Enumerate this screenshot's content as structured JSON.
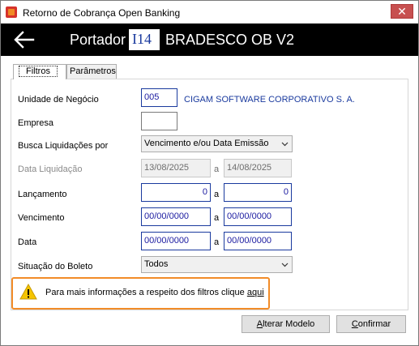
{
  "window": {
    "title": "Retorno de Cobrança Open Banking",
    "close_glyph": "✕"
  },
  "header": {
    "back_icon": "back-arrow-icon",
    "portador_label": "Portador",
    "portador_code": "I14",
    "portador_name": "BRADESCO OB V2"
  },
  "tabs": [
    {
      "label": "Filtros",
      "active": true
    },
    {
      "label": "Parâmetros",
      "active": false
    }
  ],
  "form": {
    "unidade_negocio": {
      "label": "Unidade de Negócio",
      "value": "005",
      "description": "CIGAM SOFTWARE CORPORATIVO S. A."
    },
    "empresa": {
      "label": "Empresa",
      "value": ""
    },
    "busca_liquidacoes": {
      "label": "Busca Liquidações por",
      "value": "Vencimento e/ou Data Emissão"
    },
    "data_liquidacao": {
      "label": "Data Liquidação",
      "from": "13/08/2025",
      "sep": "a",
      "to": "14/08/2025"
    },
    "lancamento": {
      "label": "Lançamento",
      "from": "0",
      "sep": "a",
      "to": "0"
    },
    "vencimento": {
      "label": "Vencimento",
      "from": "00/00/0000",
      "sep": "a",
      "to": "00/00/0000"
    },
    "data": {
      "label": "Data",
      "from": "00/00/0000",
      "sep": "a",
      "to": "00/00/0000"
    },
    "situacao_boleto": {
      "label": "Situação do Boleto",
      "value": "Todos"
    }
  },
  "info": {
    "icon": "warning-icon",
    "text": "Para mais informações a respeito dos filtros clique",
    "link": "aqui",
    "highlight_color": "#f28c28"
  },
  "buttons": {
    "alterar_modelo_first": "A",
    "alterar_modelo_rest": "lterar Modelo",
    "confirmar_first": "C",
    "confirmar_rest": "onfirmar"
  }
}
